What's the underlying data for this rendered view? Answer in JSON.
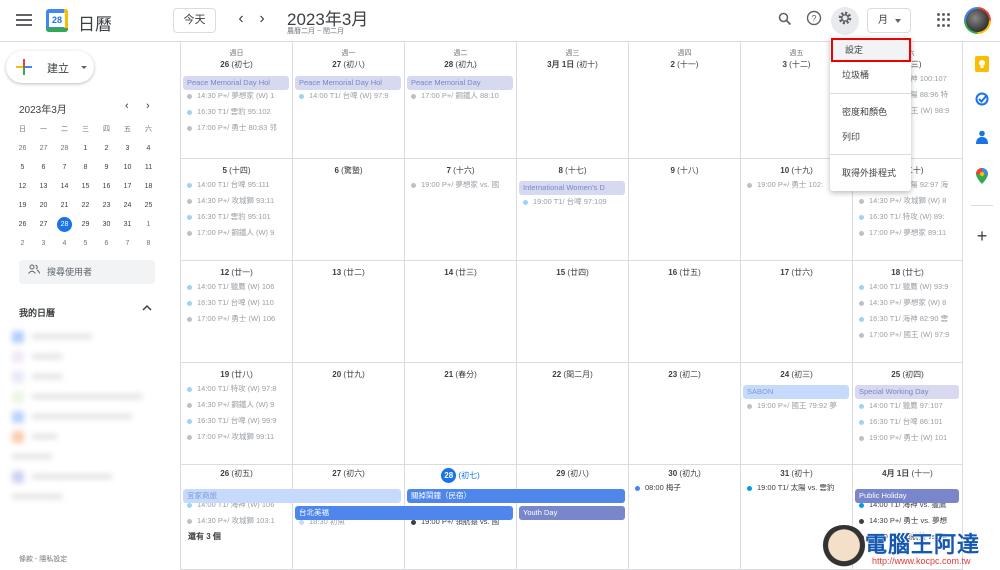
{
  "header": {
    "app_name": "日曆",
    "logo_day": "28",
    "today_button": "今天",
    "prev_icon": "‹",
    "next_icon": "›",
    "month_title": "2023年3月",
    "lunar_range": "農曆二月 ~ 閏二月",
    "search_icon": "⌕",
    "help_icon": "?",
    "settings_icon": "⚙",
    "view_select": "月"
  },
  "sidebar": {
    "create_label": "建立",
    "mini_title": "2023年3月",
    "mini_prev": "‹",
    "mini_next": "›",
    "weekdays": [
      "日",
      "一",
      "二",
      "三",
      "四",
      "五",
      "六"
    ],
    "weeks": [
      [
        "26",
        "27",
        "28",
        "1",
        "2",
        "3",
        "4"
      ],
      [
        "5",
        "6",
        "7",
        "8",
        "9",
        "10",
        "11"
      ],
      [
        "12",
        "13",
        "14",
        "15",
        "16",
        "17",
        "18"
      ],
      [
        "19",
        "20",
        "21",
        "22",
        "23",
        "24",
        "25"
      ],
      [
        "26",
        "27",
        "28",
        "29",
        "30",
        "31",
        "1"
      ],
      [
        "2",
        "3",
        "4",
        "5",
        "6",
        "7",
        "8"
      ]
    ],
    "today": "28",
    "search_users": "搜尋使用者",
    "my_calendars": "我的日曆",
    "collapse_icon": "⌃",
    "footer": "條款 - 隱私設定"
  },
  "calendar": {
    "weekdays": [
      "週日",
      "週一",
      "週二",
      "週三",
      "週四",
      "週五",
      "週六"
    ],
    "weeks": [
      [
        {
          "date": "26",
          "lunar": "(初七)",
          "events": [
            {
              "t": "14:30 P+/ 夢想家 (W) 1",
              "c": "gray"
            },
            {
              "t": "16:30 T1/ 雲豹 95:102",
              "c": "blue"
            },
            {
              "t": "17:00 P+/ 勇士 80:83 邻",
              "c": "gray"
            }
          ]
        },
        {
          "date": "27",
          "lunar": "(初八)",
          "events": [
            {
              "t": "14:00 T1/ 台啤 (W) 97:9",
              "c": "blue"
            }
          ]
        },
        {
          "date": "28",
          "lunar": "(初九)",
          "events": [
            {
              "t": "17:00 P+/ 鋼鐵人 88:10",
              "c": "gray"
            }
          ]
        },
        {
          "date": "3月 1日",
          "lunar": "(初十)",
          "events": []
        },
        {
          "date": "2",
          "lunar": "(十一)",
          "events": []
        },
        {
          "date": "3",
          "lunar": "(十二)",
          "events": []
        },
        {
          "date": "4",
          "lunar": "(十三)",
          "events": [
            {
              "t": "14:00 T1/ 海神 100:107",
              "c": "blue"
            },
            {
              "t": "16:30 T1/ 太陽 88:96 特",
              "c": "blue"
            },
            {
              "t": "17:00 P+/ 國王 (W) 98:9",
              "c": "gray"
            }
          ]
        }
      ],
      [
        {
          "date": "5",
          "lunar": "(十四)",
          "events": [
            {
              "t": "14:00 T1/ 台啤 95:111",
              "c": "blue"
            },
            {
              "t": "14:30 P+/ 攻城獅 93:11",
              "c": "gray"
            },
            {
              "t": "16:30 T1/ 雲豹 95:101",
              "c": "blue"
            },
            {
              "t": "17:00 P+/ 鋼鐵人 (W) 9",
              "c": "gray"
            }
          ]
        },
        {
          "date": "6",
          "lunar": "(驚蟄)",
          "events": []
        },
        {
          "date": "7",
          "lunar": "(十六)",
          "events": [
            {
              "t": "19:00 P+/ 夢想家 vs. 國",
              "c": "gray"
            }
          ]
        },
        {
          "date": "8",
          "lunar": "(十七)",
          "events": [
            {
              "t": "19:00 T1/ 台啤 97:109",
              "c": "blue"
            }
          ]
        },
        {
          "date": "9",
          "lunar": "(十八)",
          "events": []
        },
        {
          "date": "10",
          "lunar": "(十九)",
          "events": [
            {
              "t": "19:00 P+/ 勇士 102:",
              "c": "gray"
            }
          ]
        },
        {
          "date": "11",
          "lunar": "(二十)",
          "events": [
            {
              "t": "14:00 T1/ 太陽 92:97 海",
              "c": "blue"
            },
            {
              "t": "14:30 P+/ 攻城獅 (W) 8",
              "c": "gray"
            },
            {
              "t": "16:30 T1/ 特攻 (W) 89:",
              "c": "blue"
            },
            {
              "t": "17:00 P+/ 夢想家 89:11",
              "c": "gray"
            }
          ]
        }
      ],
      [
        {
          "date": "12",
          "lunar": "(廿一)",
          "events": [
            {
              "t": "14:00 T1/ 獵鷹 (W) 106",
              "c": "blue"
            },
            {
              "t": "16:30 T1/ 台啤 (W) 110",
              "c": "blue"
            },
            {
              "t": "17:00 P+/ 勇士 (W) 106",
              "c": "gray"
            }
          ]
        },
        {
          "date": "13",
          "lunar": "(廿二)",
          "events": []
        },
        {
          "date": "14",
          "lunar": "(廿三)",
          "events": []
        },
        {
          "date": "15",
          "lunar": "(廿四)",
          "events": []
        },
        {
          "date": "16",
          "lunar": "(廿五)",
          "events": []
        },
        {
          "date": "17",
          "lunar": "(廿六)",
          "events": []
        },
        {
          "date": "18",
          "lunar": "(廿七)",
          "events": [
            {
              "t": "14:00 T1/ 獵鷹 (W) 93:9",
              "c": "blue"
            },
            {
              "t": "14:30 P+/ 夢想家 (W) 8",
              "c": "gray"
            },
            {
              "t": "16:30 T1/ 海神 82:90 雲",
              "c": "blue"
            },
            {
              "t": "17:00 P+/ 國王 (W) 97:9",
              "c": "gray"
            }
          ]
        }
      ],
      [
        {
          "date": "19",
          "lunar": "(廿八)",
          "events": [
            {
              "t": "14:00 T1/ 特攻 (W) 97:8",
              "c": "blue"
            },
            {
              "t": "14:30 P+/ 鋼鐵人 (W) 9",
              "c": "gray"
            },
            {
              "t": "16:30 T1/ 台啤 (W) 99:9",
              "c": "blue"
            },
            {
              "t": "17:00 P+/ 攻城獅 99:11",
              "c": "gray"
            }
          ]
        },
        {
          "date": "20",
          "lunar": "(廿九)",
          "events": []
        },
        {
          "date": "21",
          "lunar": "(春分)",
          "events": []
        },
        {
          "date": "22",
          "lunar": "(閏二月)",
          "events": []
        },
        {
          "date": "23",
          "lunar": "(初二)",
          "events": []
        },
        {
          "date": "24",
          "lunar": "(初三)",
          "events": [
            {
              "t": "19:00 P+/ 國王 79:92 夢",
              "c": "gray"
            }
          ]
        },
        {
          "date": "25",
          "lunar": "(初四)",
          "events": [
            {
              "t": "14:00 T1/ 獵鷹 97:107",
              "c": "blue"
            },
            {
              "t": "16:30 T1/ 台啤 86:101",
              "c": "blue"
            },
            {
              "t": "19:00 P+/ 勇士 (W) 101",
              "c": "gray"
            }
          ]
        }
      ],
      [
        {
          "date": "26",
          "lunar": "(初五)",
          "events": [
            {
              "t": "14:00 T1/ 海神 (W) 106",
              "c": "blue"
            },
            {
              "t": "14:30 P+/ 攻城獅 103:1",
              "c": "gray"
            }
          ],
          "more": "還有 3 個"
        },
        {
          "date": "27",
          "lunar": "(初六)",
          "events": [
            {
              "t": "18:30 初魚",
              "c": "lightblue"
            }
          ]
        },
        {
          "date": "28",
          "lunar": "(初七)",
          "today": true,
          "events": [
            {
              "t": "19:00 P+/ 領航猿 vs. 國",
              "c": "dark",
              "active": true
            }
          ]
        },
        {
          "date": "29",
          "lunar": "(初八)",
          "events": []
        },
        {
          "date": "30",
          "lunar": "(初九)",
          "events": [
            {
              "t": "08:00 梅子",
              "c": "royal",
              "active": true
            }
          ]
        },
        {
          "date": "31",
          "lunar": "(初十)",
          "events": [
            {
              "t": "19:00 T1/ 太陽 vs. 雲豹",
              "c": "blue2",
              "active": true
            }
          ]
        },
        {
          "date": "4月 1日",
          "lunar": "(十一)",
          "events": [
            {
              "t": "14:00 T1/ 海神 vs. 獵鷹",
              "c": "blue2",
              "active": true
            },
            {
              "t": "14:30 P+/ 勇士 vs. 夢想",
              "c": "dark",
              "active": true
            },
            {
              "t": "17:00 P+/ 領航猿 vs. 國",
              "c": "dark",
              "active": true
            }
          ]
        }
      ]
    ],
    "chips": [
      {
        "label": "Peace Memorial Day Hol",
        "week": 0,
        "start": 0,
        "span": 1,
        "lane": 0,
        "style": "holiday"
      },
      {
        "label": "Peace Memorial Day Hol",
        "week": 0,
        "start": 1,
        "span": 1,
        "lane": 0,
        "style": "holiday"
      },
      {
        "label": "Peace Memorial Day",
        "week": 0,
        "start": 2,
        "span": 1,
        "lane": 0,
        "style": "holiday"
      },
      {
        "label": "International Women's D",
        "week": 1,
        "start": 3,
        "span": 1,
        "lane": 0,
        "style": "holiday"
      },
      {
        "label": "SABON",
        "week": 3,
        "start": 5,
        "span": 1,
        "lane": 0,
        "style": "lightblue"
      },
      {
        "label": "Special Working Day",
        "week": 3,
        "start": 6,
        "span": 1,
        "lane": 0,
        "style": "holiday"
      },
      {
        "label": "宜家商旅",
        "week": 4,
        "start": 0,
        "span": 2,
        "lane": 0,
        "style": "lightblue"
      },
      {
        "label": "關掉鬧鐘（民宿）",
        "week": 4,
        "start": 2,
        "span": 2,
        "lane": 0,
        "style": "royal"
      },
      {
        "label": "台北美福",
        "week": 4,
        "start": 1,
        "span": 2,
        "lane": 1,
        "style": "royal"
      },
      {
        "label": "Youth Day",
        "week": 4,
        "start": 3,
        "span": 1,
        "lane": 1,
        "style": "lavender"
      },
      {
        "label": "Public Holiday",
        "week": 4,
        "start": 6,
        "span": 1,
        "lane": 0,
        "style": "lavender"
      }
    ],
    "colors": {
      "gray": "#bdc1c6",
      "blue": "#9fd3f2",
      "lightblue": "#c6dafc",
      "dark": "#3c4043",
      "royal": "#4285f4",
      "blue2": "#039be5",
      "holiday_bg": "#d6d9ef",
      "holiday_fg": "#7986cb",
      "lightblue_bg": "#c6dafc",
      "lightblue_fg": "#7b9bd6",
      "royal_bg": "#4f86ec",
      "lavender_bg": "#7986cb"
    }
  },
  "settings_menu": {
    "items": [
      "設定",
      "垃圾桶",
      "密度和顏色",
      "列印",
      "取得外掛程式"
    ],
    "highlighted": "設定"
  },
  "right_panel": {
    "icons": [
      "keep-icon",
      "tasks-icon",
      "contacts-icon",
      "maps-icon",
      "add-icon"
    ],
    "add_label": "+"
  },
  "watermark": {
    "text": "電腦王阿達",
    "url": "http://www.kocpc.com.tw"
  }
}
